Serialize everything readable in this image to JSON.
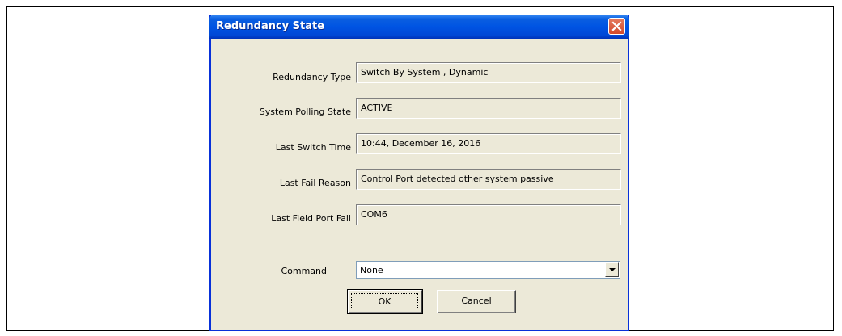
{
  "dialog": {
    "title": "Redundancy State",
    "rows": [
      {
        "label": "Redundancy Type",
        "value": "Switch By System , Dynamic"
      },
      {
        "label": "System Polling State",
        "value": "ACTIVE"
      },
      {
        "label": "Last Switch Time",
        "value": "10:44, December 16, 2016"
      },
      {
        "label": "Last Fail Reason",
        "value": "Control Port detected other system passive"
      },
      {
        "label": "Last Field Port Fail",
        "value": "COM6"
      }
    ],
    "command": {
      "label": "Command",
      "selected": "None"
    },
    "buttons": {
      "ok": "OK",
      "cancel": "Cancel"
    }
  },
  "colors": {
    "titlebar": "#0054e3",
    "dialog_bg": "#ece9d8",
    "close_button": "#d2482b"
  },
  "icons": {
    "close": "close-icon",
    "dropdown": "chevron-down-icon"
  }
}
